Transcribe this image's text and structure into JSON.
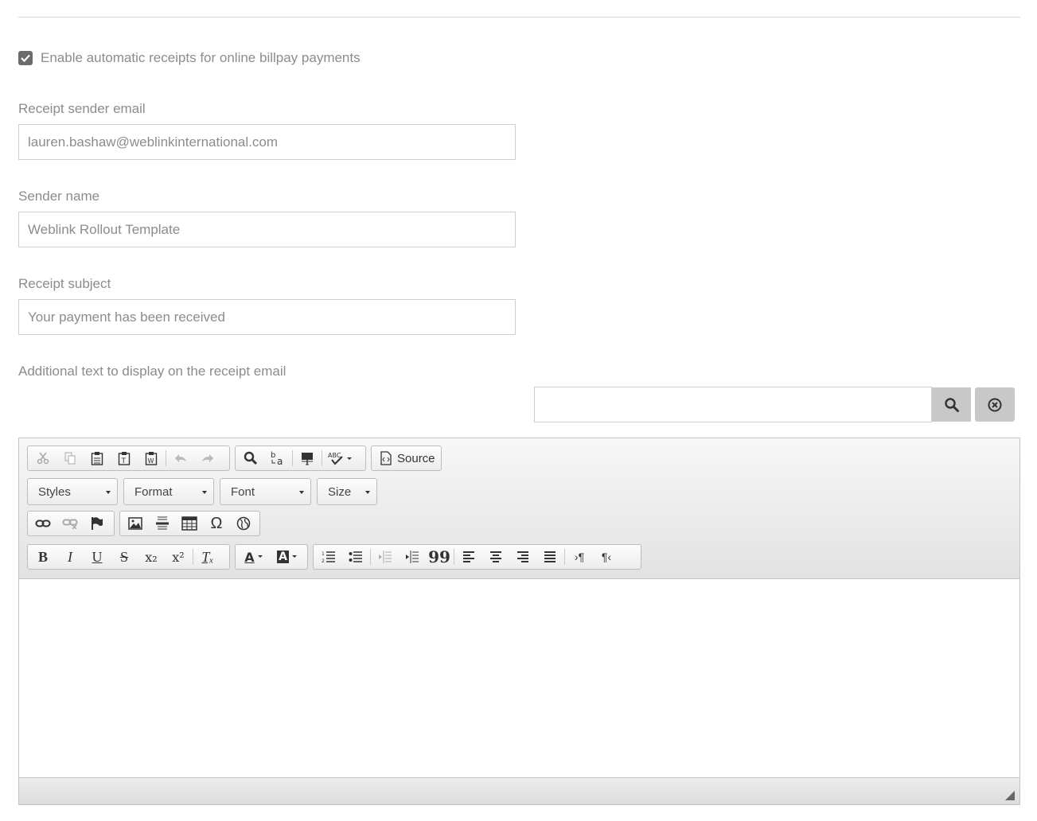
{
  "receipts": {
    "enable_label": "Enable automatic receipts for online billpay payments",
    "enabled": true
  },
  "fields": {
    "sender_email": {
      "label": "Receipt sender email",
      "value": "lauren.bashaw@weblinkinternational.com"
    },
    "sender_name": {
      "label": "Sender name",
      "value": "Weblink Rollout Template"
    },
    "subject": {
      "label": "Receipt subject",
      "value": "Your payment has been received"
    }
  },
  "additional_text": {
    "label": "Additional text to display on the receipt email",
    "search_value": ""
  },
  "editor": {
    "source_label": "Source",
    "combos": {
      "styles": "Styles",
      "format": "Format",
      "font": "Font",
      "size": "Size"
    },
    "glyphs": {
      "bold": "B",
      "italic": "I",
      "underline": "U",
      "strike": "S",
      "subscript": "x₂",
      "superscript": "x²",
      "remove_format": "Tₓ",
      "omega": "Ω",
      "text_color": "A",
      "bg_color": "A",
      "quote": "99",
      "ltr": "›¶",
      "rtl": "¶‹",
      "spellcheck": "ABC"
    }
  },
  "colors": {
    "checkbox": "#6b6b6b",
    "button_bg": "#c8c8c8",
    "text": "#8c8c8c"
  }
}
